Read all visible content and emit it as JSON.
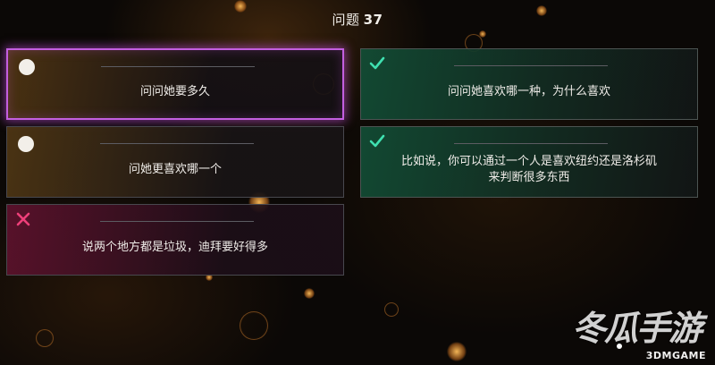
{
  "header": {
    "title_prefix": "问题",
    "question_number": "37"
  },
  "options": [
    {
      "text": "问问她要多久",
      "status": "selected"
    },
    {
      "text": "问问她喜欢哪一种，为什么喜欢",
      "status": "correct"
    },
    {
      "text": "问她更喜欢哪一个",
      "status": "neutral"
    },
    {
      "text": "比如说，你可以通过一个人是喜欢纽约还是洛杉矶来判断很多东西",
      "status": "correct"
    },
    {
      "text": "说两个地方都是垃圾，迪拜要好得多",
      "status": "wrong"
    }
  ],
  "colors": {
    "selected_border": "#c35fe0",
    "correct_check": "#3fe0b0",
    "wrong_cross": "#ee3f7a"
  },
  "watermark": {
    "main": "冬瓜手游",
    "sub": "3DMGAME"
  }
}
